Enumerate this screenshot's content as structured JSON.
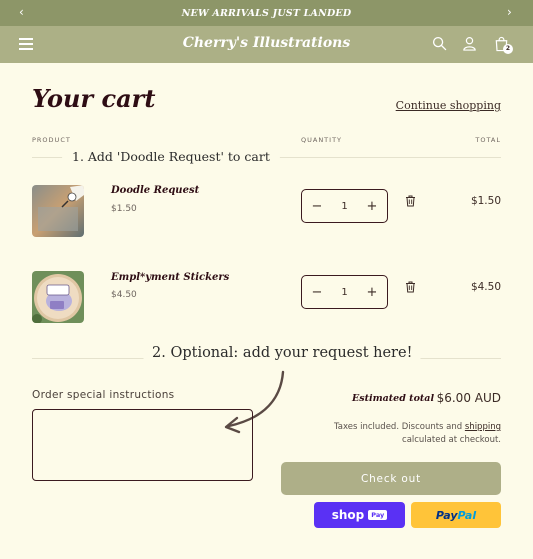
{
  "announcement": {
    "text": "NEW ARRIVALS JUST LANDED",
    "prev_icon": "chevron-left-icon",
    "next_icon": "chevron-right-icon"
  },
  "header": {
    "brand": "Cherry's Illustrations",
    "cart_count": "2",
    "icons": [
      "menu-icon",
      "search-icon",
      "account-icon",
      "cart-icon"
    ]
  },
  "cart": {
    "title": "Your cart",
    "continue_link": "Continue shopping",
    "columns": {
      "product": "PRODUCT",
      "quantity": "QUANTITY",
      "total": "TOTAL"
    },
    "items": [
      {
        "name": "Doodle Request",
        "price": "$1.50",
        "quantity": "1",
        "total": "$1.50"
      },
      {
        "name": "Empl*yment Stickers",
        "price": "$4.50",
        "quantity": "1",
        "total": "$4.50"
      }
    ]
  },
  "annotations": {
    "step1": "1. Add 'Doodle Request' to cart",
    "step2": "2. Optional: add your request here!"
  },
  "order": {
    "instructions_label": "Order special instructions",
    "instructions_value": "",
    "estimated_label": "Estimated total",
    "estimated_value": "$6.00 AUD",
    "taxes_before": "Taxes included. Discounts and ",
    "taxes_link": "shipping",
    "taxes_after": "calculated at checkout.",
    "checkout_label": "Check out",
    "shoppay": {
      "shop": "shop",
      "pay": "Pay"
    },
    "paypal": {
      "pay": "Pay",
      "pal": "Pal"
    }
  },
  "colors": {
    "announcement_bg": "#8d9668",
    "header_bg": "#acb086",
    "page_bg": "#fdfbe9",
    "title": "#2e0d14",
    "checkout_bg": "#aeaf88",
    "shoppay_bg": "#5a31f4",
    "paypal_bg": "#ffc439"
  }
}
